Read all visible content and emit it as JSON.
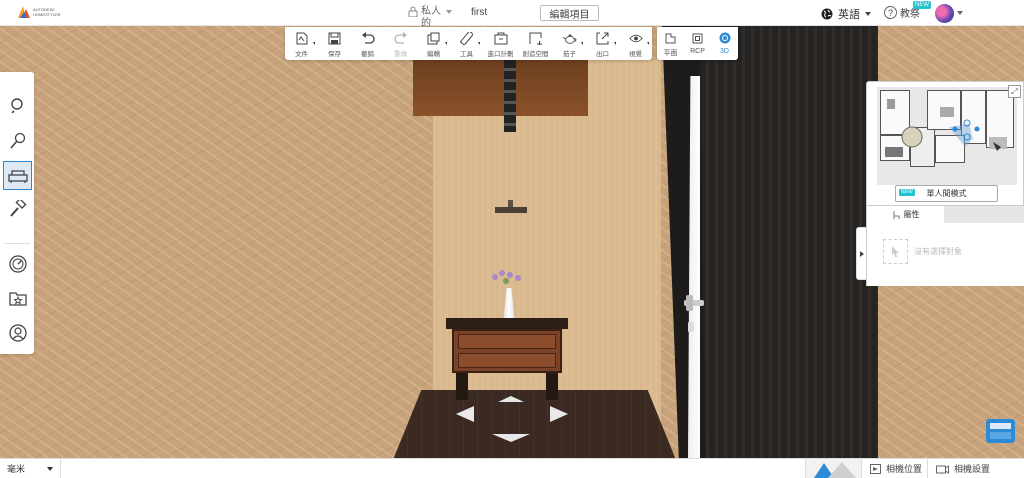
{
  "topbar": {
    "logo_text": "AUTODESK HOMESTYLER",
    "privacy_label": "私人的",
    "design_name": "first",
    "edit_project_label": "編輯項目",
    "language_label": "英語",
    "help_label": "教祭",
    "new_badge": "NEW"
  },
  "toolbar": {
    "tools": [
      {
        "label": "文件",
        "icon": "file-icon"
      },
      {
        "label": "保存",
        "icon": "save-icon"
      },
      {
        "label": "撤銷",
        "icon": "undo-icon"
      },
      {
        "label": "重做",
        "icon": "redo-icon"
      },
      {
        "label": "編輯",
        "icon": "edit-icon"
      },
      {
        "label": "工具",
        "icon": "ruler-icon"
      },
      {
        "label": "進口計劃",
        "icon": "import-plan-icon"
      },
      {
        "label": "創造空間",
        "icon": "create-space-icon"
      },
      {
        "label": "茄子",
        "icon": "teapot-icon"
      },
      {
        "label": "出口",
        "icon": "export-icon"
      },
      {
        "label": "視覺",
        "icon": "eye-icon"
      }
    ],
    "views": [
      {
        "label": "平面",
        "icon": "floorplan-icon"
      },
      {
        "label": "RCP",
        "icon": "rcp-icon"
      },
      {
        "label": "3D",
        "icon": "3d-icon"
      }
    ]
  },
  "left_sidebar": {
    "items": [
      "search-icon",
      "paint-brush-icon",
      "sofa-icon",
      "roller-icon",
      "dashboard-icon",
      "favorites-folder-icon",
      "user-icon"
    ]
  },
  "minimap": {
    "new_badge": "NEW",
    "single_room_label": "單人間模式"
  },
  "properties": {
    "tab_label": "屬性",
    "empty_text": "沒有選擇對象"
  },
  "bottombar": {
    "unit": "毫米",
    "camera_position_label": "相機位置",
    "camera_settings_label": "相機設置"
  },
  "colors": {
    "accent": "#2d8ad6",
    "badge": "#24c2cf",
    "wall": "#c7a27a",
    "door": "#262422"
  }
}
